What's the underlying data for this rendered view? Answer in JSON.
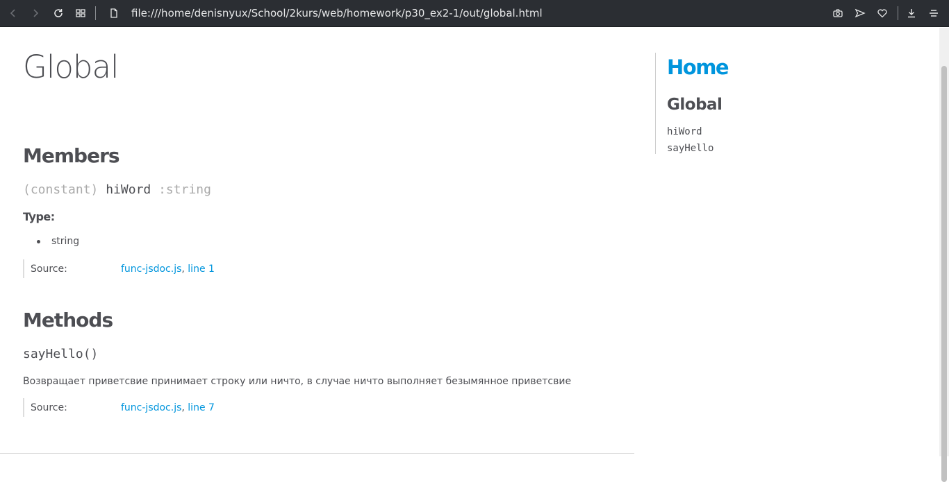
{
  "browser": {
    "url": "file:///home/denisnyux/School/2kurs/web/homework/p30_ex2-1/out/global.html"
  },
  "page": {
    "title": "Global",
    "members_heading": "Members",
    "member": {
      "attribs": "(constant)",
      "name": "hiWord",
      "type_sig": ":string",
      "type_label": "Type:",
      "types": [
        "string"
      ],
      "source_label": "Source:",
      "source_file": "func-jsdoc.js",
      "source_sep": ",",
      "source_line": "line 1"
    },
    "methods_heading": "Methods",
    "method": {
      "signature": "sayHello()",
      "description": "Возвращает приветсвие принимает строку или ничто, в случае ничто выполняет безымянное приветсвие",
      "source_label": "Source:",
      "source_file": "func-jsdoc.js",
      "source_sep": ",",
      "source_line": "line 7"
    }
  },
  "nav": {
    "home": "Home",
    "section": "Global",
    "items": [
      "hiWord",
      "sayHello"
    ]
  },
  "colors": {
    "link": "#0095dd",
    "text": "#4d4e53",
    "toolbar_bg": "#2b2e33"
  }
}
